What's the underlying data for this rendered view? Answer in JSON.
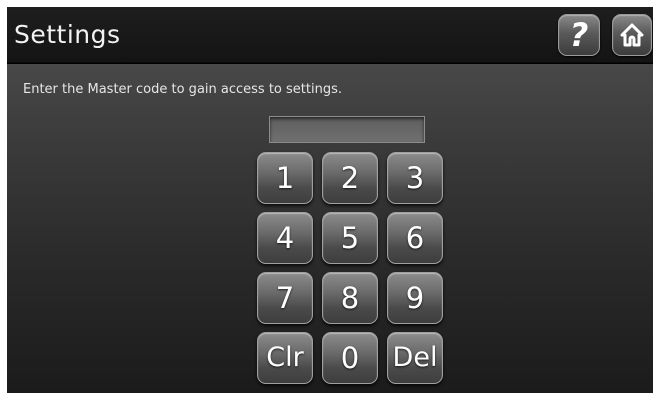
{
  "header": {
    "title": "Settings",
    "help_icon": "question-mark-icon",
    "help_glyph": "?",
    "home_icon": "home-icon"
  },
  "prompt": "Enter the Master code to gain access to settings.",
  "code_field": {
    "value": ""
  },
  "keypad": {
    "keys": [
      "1",
      "2",
      "3",
      "4",
      "5",
      "6",
      "7",
      "8",
      "9",
      "Clr",
      "0",
      "Del"
    ]
  },
  "colors": {
    "background": "#000000",
    "header": "#1a1a1a",
    "text": "#ffffff"
  }
}
